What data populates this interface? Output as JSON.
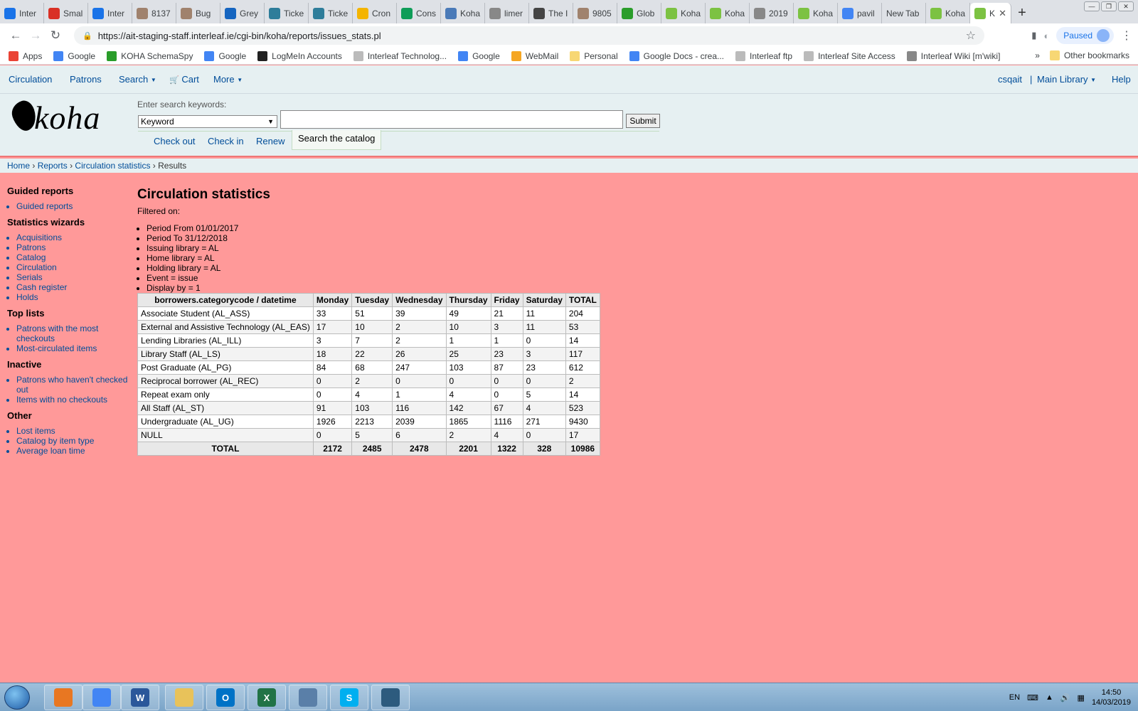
{
  "browser": {
    "tabs": [
      {
        "label": "Inter",
        "icon": "calendar-icon",
        "color": "#1a73e8"
      },
      {
        "label": "Smal",
        "icon": "gmail-icon",
        "color": "#d93025"
      },
      {
        "label": "Inter",
        "icon": "calendar-icon",
        "color": "#1a73e8"
      },
      {
        "label": "8137",
        "icon": "bug-icon",
        "color": "#a0826d"
      },
      {
        "label": "Bug",
        "icon": "bug-icon",
        "color": "#a0826d"
      },
      {
        "label": "Grey",
        "icon": "dollar-icon",
        "color": "#1565c0"
      },
      {
        "label": "Ticke",
        "icon": "ticket-icon",
        "color": "#2e7d9a"
      },
      {
        "label": "Ticke",
        "icon": "ticket-icon",
        "color": "#2e7d9a"
      },
      {
        "label": "Cron",
        "icon": "drive-icon",
        "color": "#f4b400"
      },
      {
        "label": "Cons",
        "icon": "sheets-icon",
        "color": "#0f9d58"
      },
      {
        "label": "Koha",
        "icon": "koha-icon",
        "color": "#4a7ab8"
      },
      {
        "label": "limer",
        "icon": "wiki-icon",
        "color": "#888888"
      },
      {
        "label": "The I",
        "icon": "k-icon",
        "color": "#444444"
      },
      {
        "label": "9805",
        "icon": "bug-icon",
        "color": "#a0826d"
      },
      {
        "label": "Glob",
        "icon": "koha-green-icon",
        "color": "#2a9d2a"
      },
      {
        "label": "Koha",
        "icon": "koha-k-icon",
        "color": "#7cc242"
      },
      {
        "label": "Koha",
        "icon": "koha-k-icon",
        "color": "#7cc242"
      },
      {
        "label": "2019",
        "icon": "page-icon",
        "color": "#888888"
      },
      {
        "label": "Koha",
        "icon": "koha-k-icon",
        "color": "#7cc242"
      },
      {
        "label": "pavil",
        "icon": "google-icon",
        "color": "#4285f4"
      },
      {
        "label": "New Tab",
        "icon": "",
        "color": ""
      },
      {
        "label": "Koha",
        "icon": "koha-k-icon",
        "color": "#7cc242"
      },
      {
        "label": "K",
        "icon": "koha-k-icon",
        "color": "#7cc242",
        "active": true
      }
    ],
    "new_tab": "+",
    "url": "https://ait-staging-staff.interleaf.ie/cgi-bin/koha/reports/issues_stats.pl",
    "profile_label": "Paused",
    "bookmarks": [
      {
        "label": "Apps",
        "icon": "apps-icon",
        "color": "#ea4335"
      },
      {
        "label": "Google",
        "icon": "google-icon",
        "color": "#4285f4"
      },
      {
        "label": "KOHA SchemaSpy",
        "icon": "koha-green-icon",
        "color": "#2a9d2a"
      },
      {
        "label": "Google",
        "icon": "google-icon",
        "color": "#4285f4"
      },
      {
        "label": "LogMeIn Accounts",
        "icon": "logmein-icon",
        "color": "#222222"
      },
      {
        "label": "Interleaf Technolog...",
        "icon": "page-icon",
        "color": "#bbbbbb"
      },
      {
        "label": "Google",
        "icon": "google-icon",
        "color": "#4285f4"
      },
      {
        "label": "WebMail",
        "icon": "webmail-icon",
        "color": "#f5a623"
      },
      {
        "label": "Personal",
        "icon": "folder-icon",
        "color": "#f7d774"
      },
      {
        "label": "Google Docs - crea...",
        "icon": "docs-icon",
        "color": "#4285f4"
      },
      {
        "label": "Interleaf ftp",
        "icon": "page-icon",
        "color": "#bbbbbb"
      },
      {
        "label": "Interleaf Site Access",
        "icon": "page-icon",
        "color": "#bbbbbb"
      },
      {
        "label": "Interleaf Wiki [m'wiki]",
        "icon": "wiki-icon",
        "color": "#888888"
      }
    ],
    "bookmarks_overflow": "»",
    "other_bookmarks": "Other bookmarks"
  },
  "koha": {
    "nav": {
      "circulation": "Circulation",
      "patrons": "Patrons",
      "search": "Search",
      "cart": "Cart",
      "more": "More",
      "user": "csqait",
      "separator": "|",
      "library": "Main Library",
      "help": "Help"
    },
    "logo_text": "koha",
    "search_hint": "Enter search keywords:",
    "search_type": "Keyword",
    "search_value": "",
    "submit_label": "Submit",
    "search_tabs": [
      "Check out",
      "Check in",
      "Renew",
      "Search the catalog"
    ],
    "breadcrumbs": {
      "home": "Home",
      "reports": "Reports",
      "circ_stats": "Circulation statistics",
      "current": "Results",
      "sep": "›"
    },
    "sidebar": {
      "guided_heading": "Guided reports",
      "guided_items": [
        "Guided reports"
      ],
      "wizards_heading": "Statistics wizards",
      "wizards_items": [
        "Acquisitions",
        "Patrons",
        "Catalog",
        "Circulation",
        "Serials",
        "Cash register",
        "Holds"
      ],
      "top_heading": "Top lists",
      "top_items": [
        "Patrons with the most checkouts",
        "Most-circulated items"
      ],
      "inactive_heading": "Inactive",
      "inactive_items": [
        "Patrons who haven't checked out",
        "Items with no checkouts"
      ],
      "other_heading": "Other",
      "other_items": [
        "Lost items",
        "Catalog by item type",
        "Average loan time"
      ]
    },
    "main": {
      "title": "Circulation statistics",
      "filtered_on": "Filtered on:",
      "filters": [
        "Period From 01/01/2017",
        "Period To 31/12/2018",
        "Issuing library = AL",
        "Home library = AL",
        "Holding library = AL",
        "Event = issue",
        "Display by = 1"
      ],
      "table": {
        "headers": [
          "borrowers.categorycode / datetime",
          "Monday",
          "Tuesday",
          "Wednesday",
          "Thursday",
          "Friday",
          "Saturday",
          "TOTAL"
        ],
        "rows": [
          [
            "Associate Student (AL_ASS)",
            "33",
            "51",
            "39",
            "49",
            "21",
            "11",
            "204"
          ],
          [
            "External and Assistive Technology (AL_EAS)",
            "17",
            "10",
            "2",
            "10",
            "3",
            "11",
            "53"
          ],
          [
            "Lending Libraries (AL_ILL)",
            "3",
            "7",
            "2",
            "1",
            "1",
            "0",
            "14"
          ],
          [
            "Library Staff (AL_LS)",
            "18",
            "22",
            "26",
            "25",
            "23",
            "3",
            "117"
          ],
          [
            "Post Graduate (AL_PG)",
            "84",
            "68",
            "247",
            "103",
            "87",
            "23",
            "612"
          ],
          [
            "Reciprocal borrower (AL_REC)",
            "0",
            "2",
            "0",
            "0",
            "0",
            "0",
            "2"
          ],
          [
            "Repeat exam only",
            "0",
            "4",
            "1",
            "4",
            "0",
            "5",
            "14"
          ],
          [
            "All Staff (AL_ST)",
            "91",
            "103",
            "116",
            "142",
            "67",
            "4",
            "523"
          ],
          [
            "Undergraduate (AL_UG)",
            "1926",
            "2213",
            "2039",
            "1865",
            "1116",
            "271",
            "9430"
          ],
          [
            "NULL",
            "0",
            "5",
            "6",
            "2",
            "4",
            "0",
            "17"
          ]
        ],
        "footer": [
          "TOTAL",
          "2172",
          "2485",
          "2478",
          "2201",
          "1322",
          "328",
          "10986"
        ]
      }
    }
  },
  "taskbar": {
    "apps": [
      {
        "name": "media-player-icon",
        "label": "",
        "color": "#e87722"
      },
      {
        "name": "chrome-icon",
        "label": "",
        "color": "#4285f4"
      },
      {
        "name": "word-icon",
        "label": "W",
        "color": "#2b579a"
      },
      {
        "name": "explorer-icon",
        "label": "",
        "color": "#e8c25a"
      },
      {
        "name": "outlook-icon",
        "label": "O",
        "color": "#0072c6"
      },
      {
        "name": "excel-icon",
        "label": "X",
        "color": "#217346"
      },
      {
        "name": "control-panel-icon",
        "label": "",
        "color": "#5a7fa8"
      },
      {
        "name": "skype-icon",
        "label": "S",
        "color": "#00aff0"
      },
      {
        "name": "mysql-workbench-icon",
        "label": "",
        "color": "#2d5b7e"
      }
    ],
    "language": "EN",
    "time": "14:50",
    "date": "14/03/2019"
  }
}
